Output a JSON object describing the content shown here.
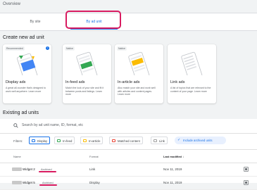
{
  "page_title": "Overview",
  "tabs": [
    {
      "label": "By site"
    },
    {
      "label": "By ad unit"
    }
  ],
  "create_section": {
    "title": "Create new ad unit",
    "cards": [
      {
        "chip": "Recommended",
        "title": "Display ads",
        "desc": "A great all-rounder that's designed to work well anywhere. Learn more"
      },
      {
        "chip": "Native",
        "title": "In-feed ads",
        "desc": "Match the look of your site and fit it between posts and listings. Learn more"
      },
      {
        "chip": "Native",
        "title": "In-article ads",
        "desc": "Also match your site and work well with articles and content pages. Learn more"
      },
      {
        "chip": "",
        "title": "Link ads",
        "desc": "A list of topics that are relevant to the content of your page. Learn more"
      }
    ]
  },
  "existing_section": {
    "title": "Existing ad units",
    "search_placeholder": "Search by ad unit name, ID, format, etc",
    "filters_label": "Filters:",
    "filter_chips": [
      {
        "label": "Display",
        "selected": true,
        "color": "#1a73e8"
      },
      {
        "label": "In-feed",
        "selected": false,
        "color": "#34a853"
      },
      {
        "label": "In-article",
        "selected": false,
        "color": "#fbbc04"
      },
      {
        "label": "Matched content",
        "selected": false,
        "color": "#ea4335"
      },
      {
        "label": "Link",
        "selected": false,
        "color": "#9e9e9e"
      }
    ],
    "archived_label": "Include archived units",
    "columns": {
      "name": "Name",
      "format": "Format",
      "last_modified": "Last modified"
    },
    "rows": [
      {
        "name": "Widget 2",
        "status": "Archived",
        "format": "Link",
        "date": "Nov 11, 2019"
      },
      {
        "name": "Widget 5",
        "status": "Archived",
        "format": "Display",
        "date": "Nov 11, 2019"
      }
    ]
  },
  "colors": {
    "accent": "#1a73e8",
    "highlight": "#d81b60"
  }
}
